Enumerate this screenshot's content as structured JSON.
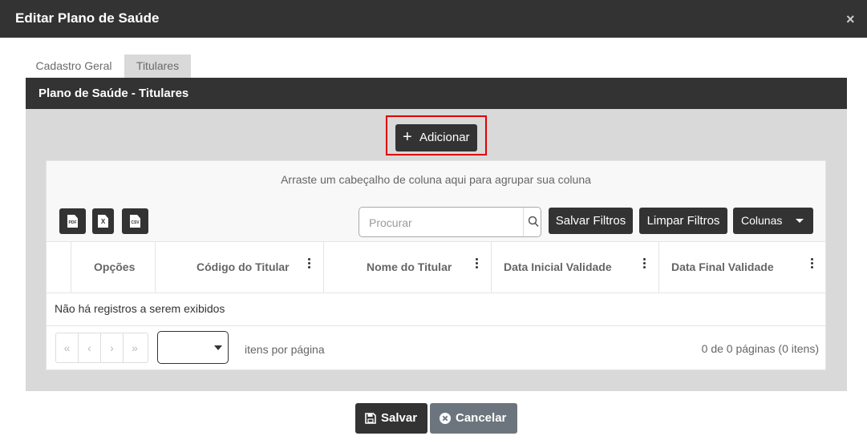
{
  "dialog": {
    "title": "Editar Plano de Saúde",
    "close_label": "×"
  },
  "tabs": [
    {
      "label": "Cadastro Geral",
      "active": false
    },
    {
      "label": "Titulares",
      "active": true
    }
  ],
  "panel": {
    "title": "Plano de Saúde - Titulares",
    "add_button_label": "Adicionar"
  },
  "grid": {
    "group_hint": "Arraste um cabeçalho de coluna aqui para agrupar sua coluna",
    "export_buttons": [
      {
        "name": "pdf",
        "label": "PDF"
      },
      {
        "name": "excel",
        "label": "X"
      },
      {
        "name": "csv",
        "label": "CSV"
      }
    ],
    "search": {
      "placeholder": "Procurar",
      "value": ""
    },
    "toolbar": {
      "save_filters": "Salvar Filtros",
      "clear_filters": "Limpar Filtros",
      "columns": "Colunas"
    },
    "columns": [
      "Opções",
      "Código do Titular",
      "Nome do Titular",
      "Data Inicial Validade",
      "Data Final Validade"
    ],
    "rows": [],
    "empty_message": "Não há registros a serem exibidos",
    "pager": {
      "nav": [
        "«",
        "‹",
        "›",
        "»"
      ],
      "page_size_value": "",
      "items_per_page_label": "itens por página",
      "info": "0 de 0 páginas (0 itens)"
    }
  },
  "footer": {
    "save_label": "Salvar",
    "cancel_label": "Cancelar"
  },
  "colors": {
    "header": "#333333",
    "panel_bg": "#d9d9d9",
    "highlight": "#e00000",
    "cancel": "#6c757d"
  }
}
